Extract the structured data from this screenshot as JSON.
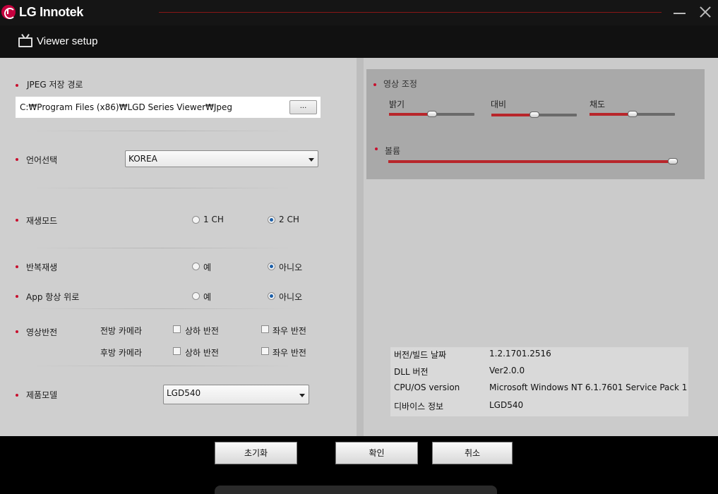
{
  "app": {
    "brand": "LG Innotek",
    "window_title": "Viewer setup"
  },
  "left": {
    "jpeg_path": {
      "label": "JPEG 저장 경로",
      "value": "C:₩Program Files (x86)₩LGD Series Viewer₩Jpeg",
      "browse_label": "..."
    },
    "language": {
      "label": "언어선택",
      "selected": "KOREA"
    },
    "playback_mode": {
      "label": "재생모드",
      "option1": "1 CH",
      "option2": "2 CH",
      "selected": "2 CH"
    },
    "repeat_play": {
      "label": "반복재생",
      "yes": "예",
      "no": "아니오",
      "selected": "아니오"
    },
    "app_on_top": {
      "label": "App 항상 위로",
      "yes": "예",
      "no": "아니오",
      "selected": "아니오"
    },
    "image_flip": {
      "label": "영상반전",
      "front_camera": "전방 카메라",
      "rear_camera": "후방 카메라",
      "vflip": "상하 반전",
      "hflip": "좌우 반전"
    },
    "product_model": {
      "label": "제품모델",
      "selected": "LGD540"
    }
  },
  "right": {
    "image_adjust": {
      "label": "영상 조정",
      "brightness": {
        "label": "밝기",
        "value": 0.5
      },
      "contrast": {
        "label": "대비",
        "value": 0.5
      },
      "saturation": {
        "label": "채도",
        "value": 0.5
      }
    },
    "volume": {
      "label": "볼륨",
      "value": 1.0
    },
    "info": [
      {
        "key": "버전/빌드 날짜",
        "value": "1.2.1701.2516"
      },
      {
        "key": "DLL 버전",
        "value": "Ver2.0.0"
      },
      {
        "key": "CPU/OS version",
        "value": "Microsoft Windows NT 6.1.7601 Service Pack 1"
      },
      {
        "key": "디바이스 정보",
        "value": "LGD540"
      }
    ]
  },
  "footer": {
    "reset_label": "초기화",
    "ok_label": "확인",
    "cancel_label": "취소"
  },
  "colors": {
    "accent": "#c8102e",
    "radio_selected": "#1c5fa8"
  }
}
